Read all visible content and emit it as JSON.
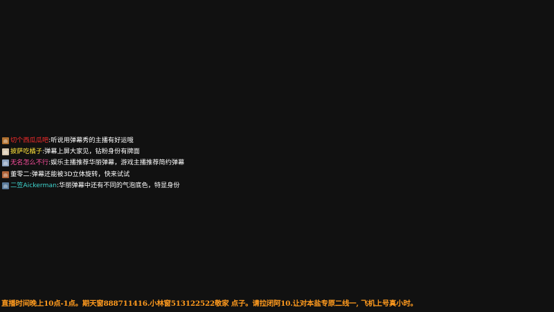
{
  "chat": {
    "messages": [
      {
        "name": "切个西瓜瓜吧",
        "sep": ":",
        "text": "听说用弹幕秀的主播有好运哦",
        "name_color": "#ff2d2d",
        "avatar_color": "#b07030"
      },
      {
        "name": "披萨吃橘子",
        "sep": ":",
        "text": "弹幕上屏大家见，钻粉身份有牌面",
        "name_color": "#ffe23a",
        "avatar_color": "#d8c8b0"
      },
      {
        "name": "无名怎么不行",
        "sep": ":",
        "text": "娱乐主播推荐华丽弹幕，游戏主播推荐简约弹幕",
        "name_color": "#ff4fa0",
        "avatar_color": "#8ea4c0"
      },
      {
        "name": "董零二",
        "sep": ":",
        "text": "弹幕还能被3D立体旋转，快来试试",
        "name_color": "#ffffff",
        "avatar_color": "#b0643a"
      },
      {
        "name": "二笠Aickerman",
        "sep": ":",
        "text": "华丽弹幕中还有不同的气泡底色，特显身份",
        "name_color": "#3fd6d0",
        "avatar_color": "#5a7a9a"
      }
    ]
  },
  "ticker": {
    "text": "直播时间晚上10点-1点。期天窗888711416.小林窗513122522敬家 点子。请拉闭阿10.让对本盐专原二线一, 飞机上号真小时。",
    "color": "#ff9a1e"
  }
}
